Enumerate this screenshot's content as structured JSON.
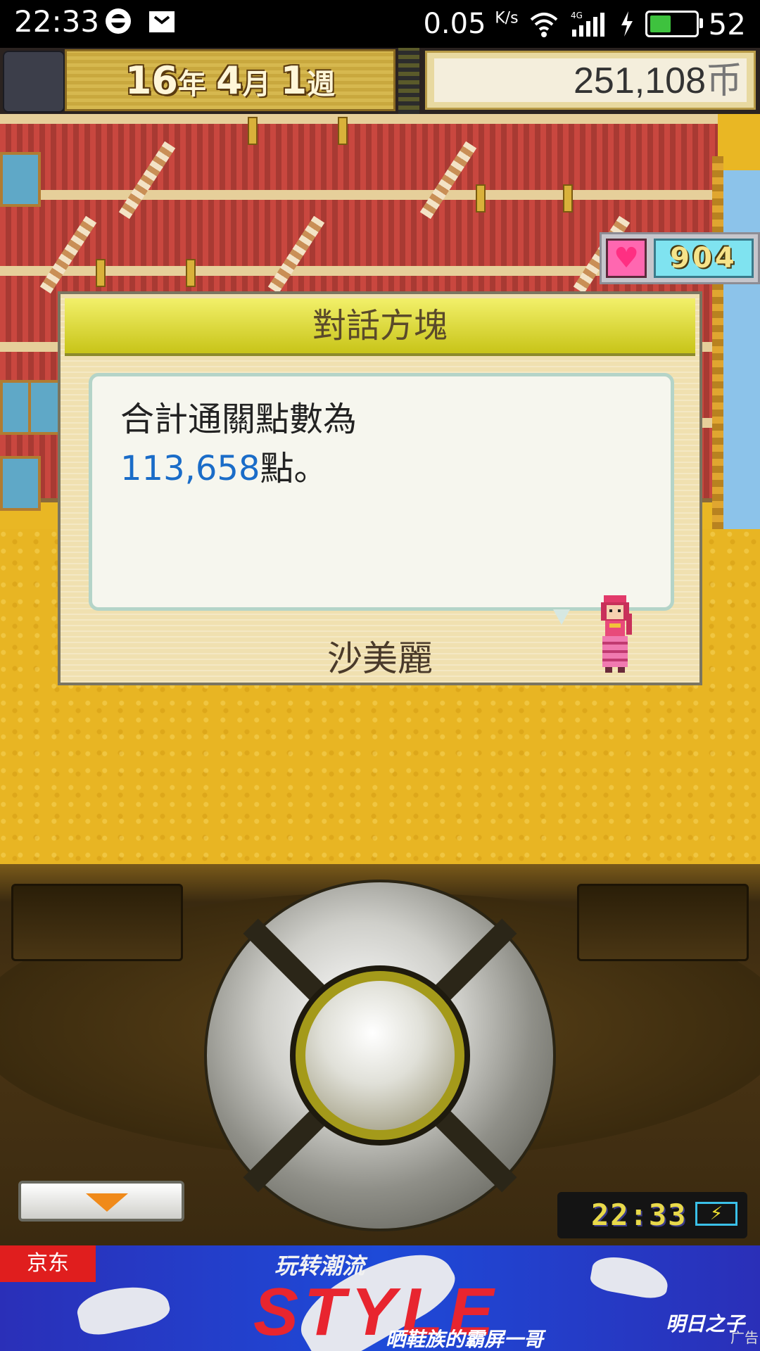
{
  "status_bar": {
    "time": "22:33",
    "net_speed": "0.05",
    "net_unit": "K/s",
    "net_type": "4G",
    "battery_level": "52",
    "battery_fraction": 0.52
  },
  "game_header": {
    "year": "16",
    "year_unit": "年",
    "month": "4",
    "month_unit": "月",
    "week": "1",
    "week_unit": "週",
    "money": "251,108",
    "money_unit": "币"
  },
  "heart_counter": {
    "value": "904",
    "icon": "heart-icon"
  },
  "dialog": {
    "title": "對話方塊",
    "line1": "合計通關點數為",
    "points": "113,658",
    "points_suffix": "點。",
    "speaker": "沙美麗"
  },
  "controls": {
    "clock": "22:33",
    "menu_icon": "triangle-down-icon"
  },
  "ad": {
    "advertiser": "京东",
    "headline": "玩转潮流",
    "big_text": "STYLE",
    "sub": "晒鞋族的霸屏一哥",
    "brand": "明日之子",
    "label": "广告"
  },
  "colors": {
    "dialog_title_bar": "#e6e23a",
    "points_blue": "#1a6cc8",
    "scene_sand": "#e8b523",
    "ad_blue": "#1e4ad8"
  }
}
